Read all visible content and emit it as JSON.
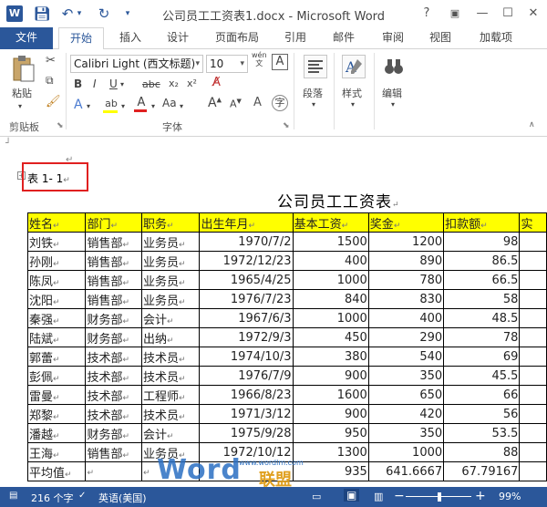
{
  "window": {
    "title": "公司员工工资表1.docx - Microsoft Word",
    "help": "?",
    "restore": "▣",
    "minimize": "—",
    "maximize": "☐",
    "close": "✕"
  },
  "tabs": {
    "file": "文件",
    "home": "开始",
    "insert": "插入",
    "design": "设计",
    "layout": "页面布局",
    "references": "引用",
    "mailings": "邮件",
    "review": "审阅",
    "view": "视图",
    "addins": "加载项"
  },
  "ribbon": {
    "paste": "粘贴",
    "clipboard": "剪贴板",
    "font_name": "Calibri Light (西文标题)",
    "font_size": "10",
    "font_group": "字体",
    "bold": "B",
    "italic": "I",
    "underline": "U",
    "strike": "abc",
    "subscript": "x₂",
    "superscript": "x²",
    "grow": "A",
    "shrink": "A",
    "case": "Aa",
    "wen": "wén",
    "paragraph": "段落",
    "styles": "样式",
    "editing": "编辑"
  },
  "doc": {
    "caption": "表 1- 1",
    "title": "公司员工工资表",
    "headers": [
      "姓名",
      "部门",
      "职务",
      "出生年月",
      "基本工资",
      "奖金",
      "扣款额",
      "实"
    ],
    "rows": [
      [
        "刘铁",
        "销售部",
        "业务员",
        "1970/7/2",
        "1500",
        "1200",
        "98"
      ],
      [
        "孙刚",
        "销售部",
        "业务员",
        "1972/12/23",
        "400",
        "890",
        "86.5"
      ],
      [
        "陈凤",
        "销售部",
        "业务员",
        "1965/4/25",
        "1000",
        "780",
        "66.5"
      ],
      [
        "沈阳",
        "销售部",
        "业务员",
        "1976/7/23",
        "840",
        "830",
        "58"
      ],
      [
        "秦强",
        "财务部",
        "会计",
        "1967/6/3",
        "1000",
        "400",
        "48.5"
      ],
      [
        "陆斌",
        "财务部",
        "出纳",
        "1972/9/3",
        "450",
        "290",
        "78"
      ],
      [
        "郭蕾",
        "技术部",
        "技术员",
        "1974/10/3",
        "380",
        "540",
        "69"
      ],
      [
        "彭佩",
        "技术部",
        "技术员",
        "1976/7/9",
        "900",
        "350",
        "45.5"
      ],
      [
        "雷曼",
        "技术部",
        "工程师",
        "1966/8/23",
        "1600",
        "650",
        "66"
      ],
      [
        "郑黎",
        "技术部",
        "技术员",
        "1971/3/12",
        "900",
        "420",
        "56"
      ],
      [
        "潘越",
        "财务部",
        "会计",
        "1975/9/28",
        "950",
        "350",
        "53.5"
      ],
      [
        "王海",
        "销售部",
        "业务员",
        "1972/10/12",
        "1300",
        "1000",
        "88"
      ],
      [
        "平均值",
        "",
        "",
        "",
        "935",
        "641.6667",
        "67.79167"
      ]
    ]
  },
  "status": {
    "words": "216 个字",
    "language": "英语(美国)",
    "zoom": "99%",
    "zoom_minus": "−",
    "zoom_plus": "+"
  },
  "watermark": {
    "brand": "Word",
    "site": "www.wordlm.com",
    "cn": "联盟"
  }
}
